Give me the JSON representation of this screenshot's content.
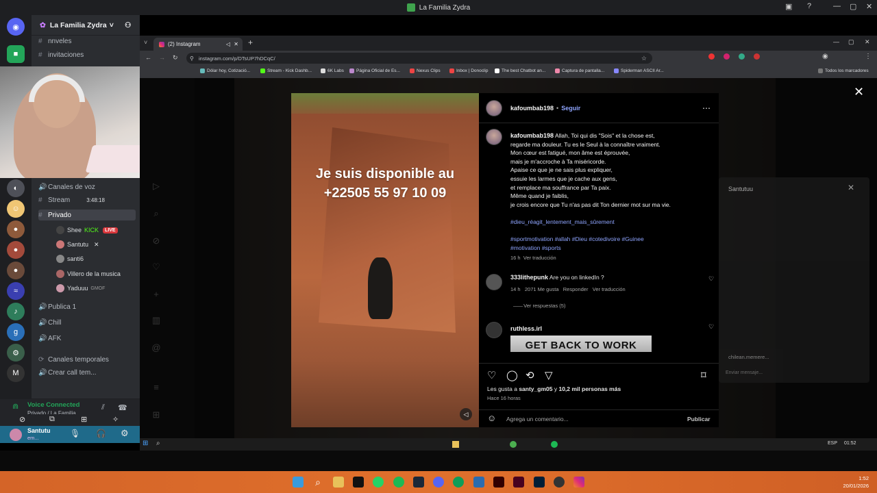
{
  "window": {
    "title": "La Familia Zydra"
  },
  "discord": {
    "server_name": "La Familia Zydra",
    "channels": [
      {
        "glyph": "#",
        "label": "nnveles"
      },
      {
        "glyph": "#",
        "label": "invitaciones"
      },
      {
        "glyph": "🔊",
        "label": "Canales de voz"
      },
      {
        "glyph": "#",
        "label": "Stream"
      },
      {
        "glyph": "#",
        "label": "Privado"
      },
      {
        "glyph": "🔊",
        "label": "Publica 1"
      },
      {
        "glyph": "🔊",
        "label": "Chill"
      },
      {
        "glyph": "🔊",
        "label": "AFK"
      },
      {
        "glyph": "⟳",
        "label": "Canales temporales"
      },
      {
        "glyph": "🔊",
        "label": "Crear call tem..."
      }
    ],
    "stream_count": "3:48:18",
    "private_users": [
      {
        "name": "Shee",
        "badge": "KICK",
        "live": "LIVE"
      },
      {
        "name": "Santutu",
        "badge": ""
      },
      {
        "name": "santi6",
        "badge": ""
      },
      {
        "name": "Villero de la musica",
        "badge": ""
      },
      {
        "name": "Yaduuu",
        "badge": "GMOF"
      }
    ],
    "voice": {
      "status": "Voice Connected",
      "channel": "Privado / La Familia..."
    },
    "user": {
      "name": "Santutu",
      "status": "em..."
    }
  },
  "browser": {
    "tab_title": "(2) Instagram",
    "url": "instagram.com/p/DTsUP7hDCqC/",
    "bookmarks": [
      "Dólar hoy, Cotizació...",
      "Stream - Kick Dashb...",
      "6K Labs",
      "Página Oficial de Es...",
      "Nexus Clips",
      "Inbox | Donoclip",
      "The best Chatbot an...",
      "Captura de pantalla...",
      "Spiderman ASCII Ar..."
    ],
    "all_bookmarks": "Todos los marcadores"
  },
  "post": {
    "overlay_text_1": "Je suis disponible au",
    "overlay_text_2": "+22505 55 97 10 09",
    "author": "kafoumbab198",
    "follow": "Seguir",
    "caption_lines": [
      "Allah, Toi qui dis \"Sois\" et la chose est,",
      "regarde ma douleur. Tu es le Seul à la connaître vraiment.",
      "Mon cœur est fatigué, mon âme est éprouvée,",
      "mais je m'accroche à Ta miséricorde.",
      "Apaise ce que je ne sais plus expliquer,",
      "essuie les larmes que je cache aux gens,",
      "et remplace ma souffrance par Ta paix.",
      "Même quand je faiblis,",
      "je crois encore que Tu n'as pas dit Ton dernier mot sur ma vie."
    ],
    "hashtag_1": "#dieu_réagit_lentement_mais_sûrement",
    "hashtags_2": "#sportmotivation #allah #Dieu #cotedivoire #Guinee",
    "hashtags_3": "#motivation #sports",
    "caption_time": "16 h",
    "translate": "Ver traducción",
    "comment1": {
      "user": "333lithepunk",
      "text": "Are you on linkedIn ?",
      "time": "14 h",
      "likes": "2071 Me gusta",
      "reply": "Responder",
      "translate": "Ver traducción",
      "replies": "Ver respuestas (5)"
    },
    "comment2": {
      "user": "ruthless.irl",
      "gif_text": "GET BACK TO WORK"
    },
    "likes_prefix": "Les gusta a",
    "likes_user": "santy_gm05",
    "likes_mid": "y",
    "likes_count": "10,2 mil personas más",
    "posted": "Hace 16 horas",
    "comment_placeholder": "Agrega un comentario...",
    "publish": "Publicar"
  },
  "chat_popup": {
    "name": "Santutuu",
    "preview_user": "chilean.memere...",
    "input": "Enviar mensaje..."
  },
  "inner_taskbar": {
    "lang": "ESP",
    "time": "01:52"
  },
  "taskbar": {
    "time": "1:52",
    "date": "20/01/2026"
  }
}
